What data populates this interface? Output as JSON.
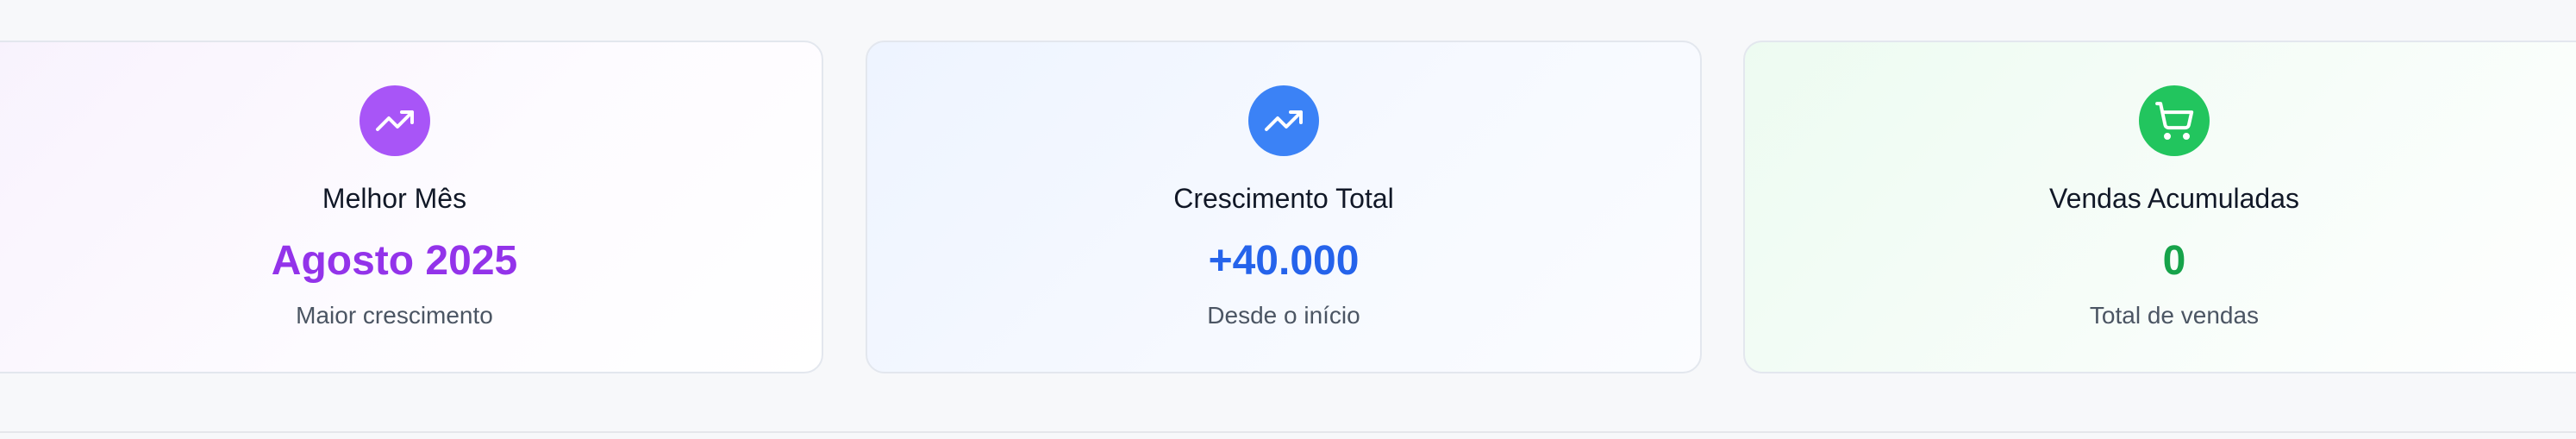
{
  "cards": [
    {
      "title": "Melhor Mês",
      "value": "Agosto 2025",
      "subtitle": "Maior crescimento",
      "icon": "trending-up-icon",
      "accent": "#a855f7",
      "value_color": "#9333ea"
    },
    {
      "title": "Crescimento Total",
      "value": "+40.000",
      "subtitle": "Desde o início",
      "icon": "trending-up-icon",
      "accent": "#3b82f6",
      "value_color": "#2563eb"
    },
    {
      "title": "Vendas Acumuladas",
      "value": "0",
      "subtitle": "Total de vendas",
      "icon": "shopping-cart-icon",
      "accent": "#22c55e",
      "value_color": "#16a34a"
    }
  ]
}
